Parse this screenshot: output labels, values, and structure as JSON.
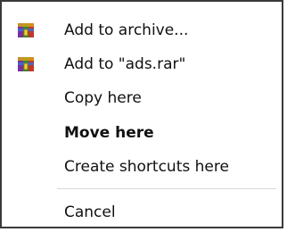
{
  "context_menu": {
    "items": [
      {
        "label": "Add to archive...",
        "icon": "winrar-icon",
        "bold": false
      },
      {
        "label": "Add to \"ads.rar\"",
        "icon": "winrar-icon",
        "bold": false
      },
      {
        "label": "Copy here",
        "icon": "",
        "bold": false
      },
      {
        "label": "Move here",
        "icon": "",
        "bold": true
      },
      {
        "label": "Create shortcuts here",
        "icon": "",
        "bold": false
      },
      {
        "label": "Cancel",
        "icon": "",
        "bold": false
      }
    ]
  }
}
